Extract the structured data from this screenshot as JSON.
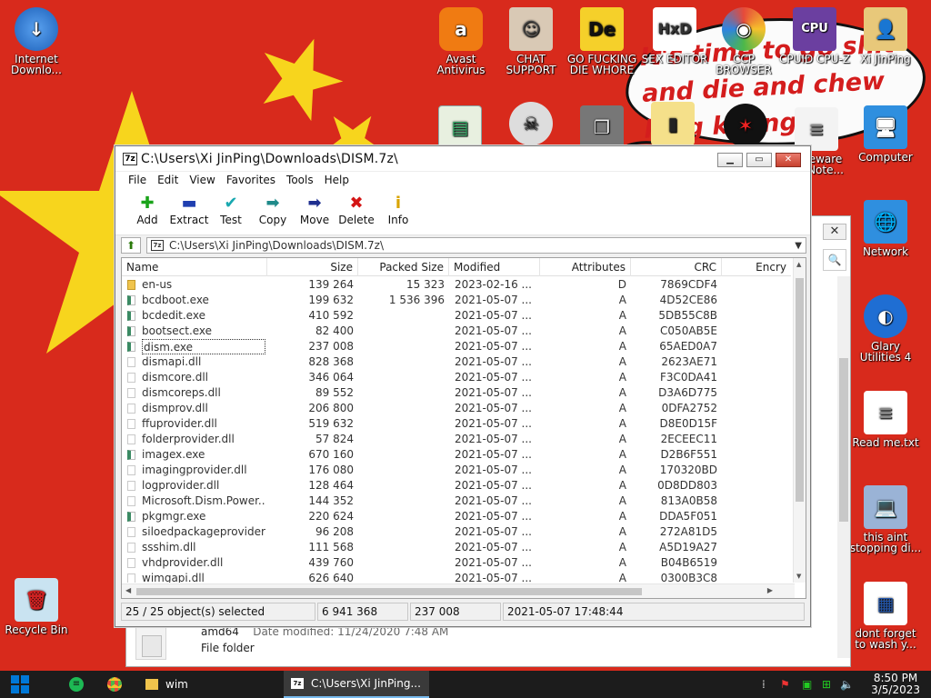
{
  "desktop": {
    "speech_text": "It's time to go shit\nand die and chew\nking killing",
    "icons": [
      {
        "id": "internet-download-manager",
        "label": "Internet Downlo...",
        "color": "#2d7be0",
        "glyph": "↓"
      },
      {
        "id": "avast",
        "label": "Avast Antivirus",
        "color": "#f07b12",
        "glyph": "a"
      },
      {
        "id": "chat-support",
        "label": "CHAT SUPPORT",
        "color": "#d9c9b5",
        "glyph": "☺"
      },
      {
        "id": "go-die",
        "label": "GO FUCKING DIE WHORE",
        "color": "#f5d02a",
        "glyph": "De"
      },
      {
        "id": "sex-editor",
        "label": "SEX EDITOR",
        "color": "#ffffff",
        "glyph": "HxD"
      },
      {
        "id": "ccp-browser",
        "label": "CCP BROWSER",
        "color": "#7bd36b",
        "glyph": "◉"
      },
      {
        "id": "cpuz",
        "label": "CPUID CPU-Z",
        "color": "#6b3fa0",
        "glyph": "CPU"
      },
      {
        "id": "xi-jinping",
        "label": "Xi JinPing",
        "color": "#e8c87a",
        "glyph": "👤"
      },
      {
        "id": "computer",
        "label": "Computer",
        "color": "#3a9ee0",
        "glyph": "🖥"
      },
      {
        "id": "network",
        "label": "Network",
        "color": "#3a9ee0",
        "glyph": "🌐"
      },
      {
        "id": "glary",
        "label": "Glary Utilities 4",
        "color": "#1f6ed3",
        "glyph": "◐"
      },
      {
        "id": "readme",
        "label": "Read me.txt",
        "color": "#ffffff",
        "glyph": "≡"
      },
      {
        "id": "this-aint",
        "label": "this aint stopping di...",
        "color": "#9ab3d6",
        "glyph": "💻"
      },
      {
        "id": "dont-forget",
        "label": "dont forget to wash y...",
        "color": "#ffffff",
        "glyph": "▦"
      },
      {
        "id": "recycle-bin",
        "label": "Recycle Bin",
        "color": "#c9e3f1",
        "glyph": "🗑"
      },
      {
        "id": "malware-note",
        "label": "eware Note...",
        "color": "#f3f3f3",
        "glyph": "≡"
      }
    ]
  },
  "explorer": {
    "item_name": "amd64",
    "item_meta": "Date modified: 11/24/2020 7:48 AM",
    "item_type": "File folder"
  },
  "zip": {
    "title": "C:\\Users\\Xi JinPing\\Downloads\\DISM.7z\\",
    "app_icon": "7z",
    "menu": [
      "File",
      "Edit",
      "View",
      "Favorites",
      "Tools",
      "Help"
    ],
    "toolbar": [
      {
        "label": "Add",
        "glyph": "✚",
        "color": "#1aa31a"
      },
      {
        "label": "Extract",
        "glyph": "▬",
        "color": "#1f3fb0"
      },
      {
        "label": "Test",
        "glyph": "✔",
        "color": "#18a8b0"
      },
      {
        "label": "Copy",
        "glyph": "➡",
        "color": "#1f8a8a"
      },
      {
        "label": "Move",
        "glyph": "➡",
        "color": "#1f2f90"
      },
      {
        "label": "Delete",
        "glyph": "✖",
        "color": "#d41515"
      },
      {
        "label": "Info",
        "glyph": "i",
        "color": "#d9a400"
      }
    ],
    "address": "C:\\Users\\Xi JinPing\\Downloads\\DISM.7z\\",
    "columns": [
      "Name",
      "Size",
      "Packed Size",
      "Modified",
      "Attributes",
      "CRC",
      "Encry"
    ],
    "files": [
      {
        "name": "en-us",
        "type": "folder",
        "size": "139 264",
        "packed": "15 323",
        "modified": "2023-02-16 ...",
        "attr": "D",
        "crc": "7869CDF4"
      },
      {
        "name": "bcdboot.exe",
        "type": "exe",
        "size": "199 632",
        "packed": "1 536 396",
        "modified": "2021-05-07 ...",
        "attr": "A",
        "crc": "4D52CE86"
      },
      {
        "name": "bcdedit.exe",
        "type": "exe",
        "size": "410 592",
        "packed": "",
        "modified": "2021-05-07 ...",
        "attr": "A",
        "crc": "5DB55C8B"
      },
      {
        "name": "bootsect.exe",
        "type": "exe",
        "size": "82 400",
        "packed": "",
        "modified": "2021-05-07 ...",
        "attr": "A",
        "crc": "C050AB5E"
      },
      {
        "name": "dism.exe",
        "type": "exe",
        "size": "237 008",
        "packed": "",
        "modified": "2021-05-07 ...",
        "attr": "A",
        "crc": "65AED0A7"
      },
      {
        "name": "dismapi.dll",
        "type": "dll",
        "size": "828 368",
        "packed": "",
        "modified": "2021-05-07 ...",
        "attr": "A",
        "crc": "2623AE71"
      },
      {
        "name": "dismcore.dll",
        "type": "dll",
        "size": "346 064",
        "packed": "",
        "modified": "2021-05-07 ...",
        "attr": "A",
        "crc": "F3C0DA41"
      },
      {
        "name": "dismcoreps.dll",
        "type": "dll",
        "size": "89 552",
        "packed": "",
        "modified": "2021-05-07 ...",
        "attr": "A",
        "crc": "D3A6D775"
      },
      {
        "name": "dismprov.dll",
        "type": "dll",
        "size": "206 800",
        "packed": "",
        "modified": "2021-05-07 ...",
        "attr": "A",
        "crc": "0DFA2752"
      },
      {
        "name": "ffuprovider.dll",
        "type": "dll",
        "size": "519 632",
        "packed": "",
        "modified": "2021-05-07 ...",
        "attr": "A",
        "crc": "D8E0D15F"
      },
      {
        "name": "folderprovider.dll",
        "type": "dll",
        "size": "57 824",
        "packed": "",
        "modified": "2021-05-07 ...",
        "attr": "A",
        "crc": "2ECEEC11"
      },
      {
        "name": "imagex.exe",
        "type": "exe",
        "size": "670 160",
        "packed": "",
        "modified": "2021-05-07 ...",
        "attr": "A",
        "crc": "D2B6F551"
      },
      {
        "name": "imagingprovider.dll",
        "type": "dll",
        "size": "176 080",
        "packed": "",
        "modified": "2021-05-07 ...",
        "attr": "A",
        "crc": "170320BD"
      },
      {
        "name": "logprovider.dll",
        "type": "dll",
        "size": "128 464",
        "packed": "",
        "modified": "2021-05-07 ...",
        "attr": "A",
        "crc": "0D8DD803"
      },
      {
        "name": "Microsoft.Dism.Power...",
        "type": "dll",
        "size": "144 352",
        "packed": "",
        "modified": "2021-05-07 ...",
        "attr": "A",
        "crc": "813A0B58"
      },
      {
        "name": "pkgmgr.exe",
        "type": "exe",
        "size": "220 624",
        "packed": "",
        "modified": "2021-05-07 ...",
        "attr": "A",
        "crc": "DDA5F051"
      },
      {
        "name": "siloedpackageprovider.dll",
        "type": "dll",
        "size": "96 208",
        "packed": "",
        "modified": "2021-05-07 ...",
        "attr": "A",
        "crc": "272A81D5"
      },
      {
        "name": "ssshim.dll",
        "type": "dll",
        "size": "111 568",
        "packed": "",
        "modified": "2021-05-07 ...",
        "attr": "A",
        "crc": "A5D19A27"
      },
      {
        "name": "vhdprovider.dll",
        "type": "dll",
        "size": "439 760",
        "packed": "",
        "modified": "2021-05-07 ...",
        "attr": "A",
        "crc": "B04B6519"
      },
      {
        "name": "wimgapi.dll",
        "type": "dll",
        "size": "626 640",
        "packed": "",
        "modified": "2021-05-07 ...",
        "attr": "A",
        "crc": "0300B3C8"
      }
    ],
    "status": {
      "selection": "25 / 25 object(s) selected",
      "total_size": "6 941 368",
      "item_size": "237 008",
      "modified": "2021-05-07 17:48:44"
    }
  },
  "taskbar": {
    "tasks": [
      {
        "label": "wim",
        "icon": "folder"
      },
      {
        "label": "C:\\Users\\Xi JinPing...",
        "icon": "7z"
      }
    ],
    "time": "8:50 PM",
    "date": "3/5/2023"
  }
}
